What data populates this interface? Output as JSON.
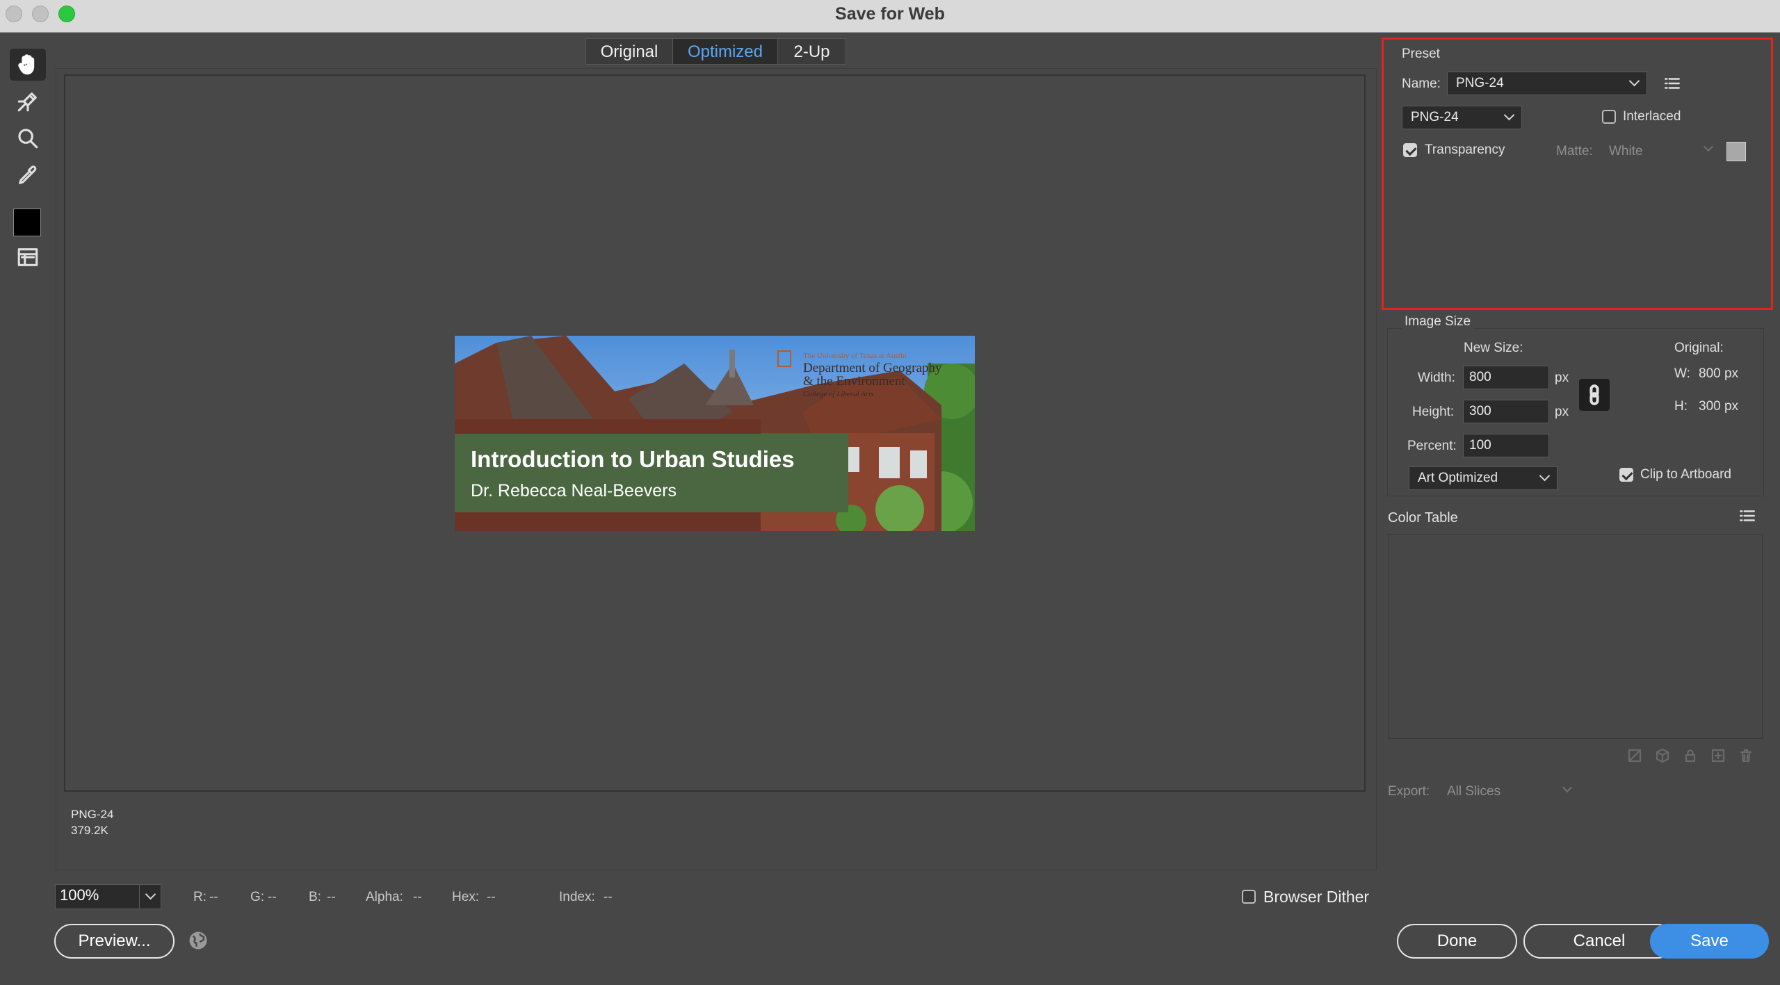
{
  "window": {
    "title": "Save for Web"
  },
  "tools": [
    {
      "name": "hand-tool",
      "icon": "hand-icon"
    },
    {
      "name": "slice-select-tool",
      "icon": "slice-select-icon"
    },
    {
      "name": "zoom-tool",
      "icon": "magnifier-icon"
    },
    {
      "name": "eyedropper-tool",
      "icon": "eyedropper-icon"
    },
    {
      "name": "eyedropper-color",
      "icon": "color-swatch-icon",
      "color": "#000000"
    },
    {
      "name": "toggle-slices",
      "icon": "slices-visibility-icon"
    }
  ],
  "view_tabs": [
    {
      "label": "Original",
      "active": false
    },
    {
      "label": "Optimized",
      "active": true
    },
    {
      "label": "2-Up",
      "active": false
    }
  ],
  "banner": {
    "title": "Introduction to Urban Studies",
    "subtitle": "Dr. Rebecca Neal-Beevers",
    "logo_line1": "The University of Texas at Austin",
    "logo_line2": "Department of Geography",
    "logo_line3": "& the Environment",
    "logo_line4": "College of Liberal Arts",
    "band_color": "#4a6741"
  },
  "optimized_info": {
    "format": "PNG-24",
    "size": "379.2K"
  },
  "status_bar": {
    "zoom": "100%",
    "r_label": "R:",
    "r_value": "--",
    "g_label": "G:",
    "g_value": "--",
    "b_label": "B:",
    "b_value": "--",
    "alpha_label": "Alpha:",
    "alpha_value": "--",
    "hex_label": "Hex:",
    "hex_value": "--",
    "index_label": "Index:",
    "index_value": "--",
    "browser_dither": "Browser Dither",
    "browser_dither_checked": false
  },
  "buttons": {
    "preview": "Preview...",
    "done": "Done",
    "cancel": "Cancel",
    "save": "Save"
  },
  "preset": {
    "section": "Preset",
    "name_label": "Name:",
    "name_value": "PNG-24",
    "format_value": "PNG-24",
    "interlaced_label": "Interlaced",
    "interlaced_checked": false,
    "transparency_label": "Transparency",
    "transparency_checked": true,
    "matte_label": "Matte:",
    "matte_value": "White"
  },
  "image_size": {
    "section": "Image Size",
    "new_size_label": "New Size:",
    "width_label": "Width:",
    "width_value": "800",
    "height_label": "Height:",
    "height_value": "300",
    "percent_label": "Percent:",
    "percent_value": "100",
    "unit": "px",
    "original_label": "Original:",
    "original_w_label": "W:",
    "original_w": "800 px",
    "original_h_label": "H:",
    "original_h": "300 px",
    "quality_value": "Art Optimized",
    "clip_label": "Clip to Artboard",
    "clip_checked": true
  },
  "color_table": {
    "section": "Color Table"
  },
  "export": {
    "label": "Export:",
    "value": "All Slices"
  }
}
